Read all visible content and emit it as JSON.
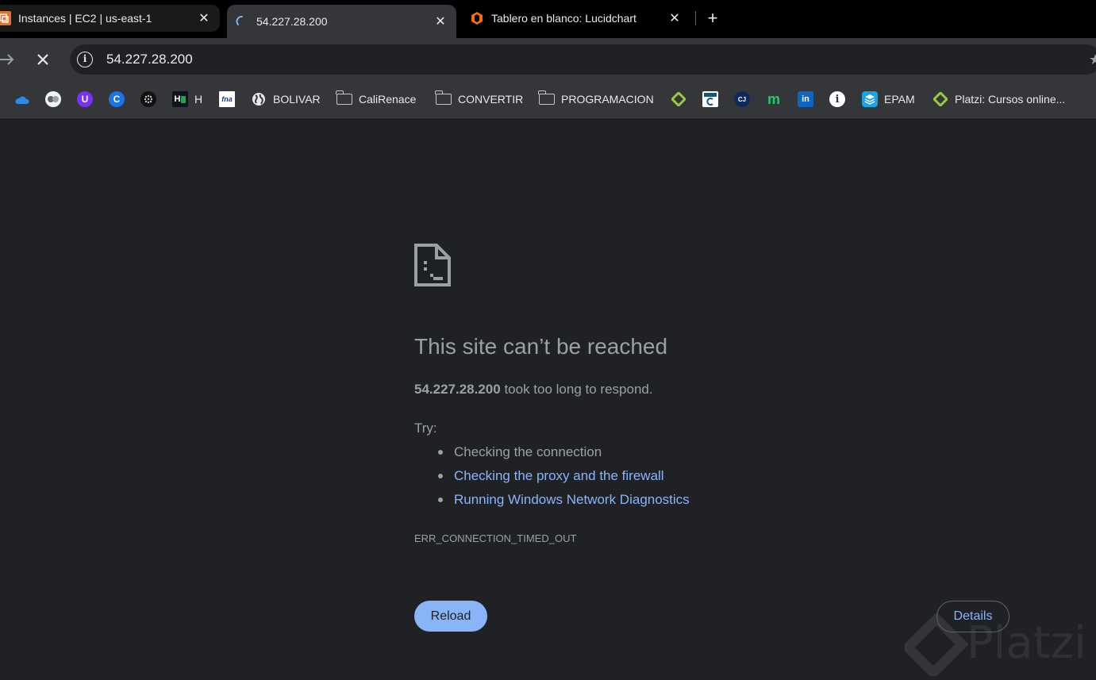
{
  "tabs": [
    {
      "title": "Instances | EC2 | us-east-1",
      "favicon": "aws-ec2-icon",
      "active": false
    },
    {
      "title": "54.227.28.200",
      "favicon": "loading-spinner-icon",
      "active": true
    },
    {
      "title": "Tablero en blanco: Lucidchart",
      "favicon": "lucidchart-icon",
      "active": false
    }
  ],
  "tab_close_glyph": "✕",
  "new_tab_glyph": "+",
  "toolbar": {
    "url": "54.227.28.200"
  },
  "bookmarks": [
    {
      "label": "",
      "icon": "onedrive-icon"
    },
    {
      "label": "",
      "icon": "chat-bubbles-icon"
    },
    {
      "label": "",
      "icon": "u-purple-icon"
    },
    {
      "label": "",
      "icon": "c-blue-icon"
    },
    {
      "label": "",
      "icon": "dots-sphere-icon"
    },
    {
      "label": "H",
      "icon": "hackerrank-icon",
      "icon_text": "H"
    },
    {
      "label": "",
      "icon": "fna-icon",
      "icon_text": "fna"
    },
    {
      "label": "BOLIVAR",
      "icon": "globe-icon"
    },
    {
      "label": "CaliRenace",
      "icon": "folder-icon"
    },
    {
      "label": "CONVERTIR",
      "icon": "folder-icon"
    },
    {
      "label": "PROGRAMACION",
      "icon": "folder-icon"
    },
    {
      "label": "",
      "icon": "platzi-icon"
    },
    {
      "label": "",
      "icon": "c-box-icon"
    },
    {
      "label": "",
      "icon": "cj-icon",
      "icon_text": "CJ"
    },
    {
      "label": "",
      "icon": "m-green-icon",
      "icon_text": "m"
    },
    {
      "label": "",
      "icon": "linkedin-icon",
      "icon_text": "in"
    },
    {
      "label": "",
      "icon": "info-circle-icon",
      "icon_text": "i"
    },
    {
      "label": "EPAM",
      "icon": "layers-icon"
    },
    {
      "label": "Platzi: Cursos online...",
      "icon": "platzi-icon"
    }
  ],
  "error": {
    "title": "This site can’t be reached",
    "host": "54.227.28.200",
    "desc_suffix": " took too long to respond.",
    "try_label": "Try:",
    "suggestions": [
      {
        "text": "Checking the connection",
        "link": false
      },
      {
        "text": "Checking the proxy and the firewall",
        "link": true
      },
      {
        "text": "Running Windows Network Diagnostics",
        "link": true
      }
    ],
    "code": "ERR_CONNECTION_TIMED_OUT",
    "reload_label": "Reload",
    "details_label": "Details"
  },
  "watermark": "Platzi",
  "colors": {
    "page_bg": "#202124",
    "toolbar_bg": "#35363a",
    "link": "#8ab4f8",
    "muted_text": "#9aa0a6"
  }
}
